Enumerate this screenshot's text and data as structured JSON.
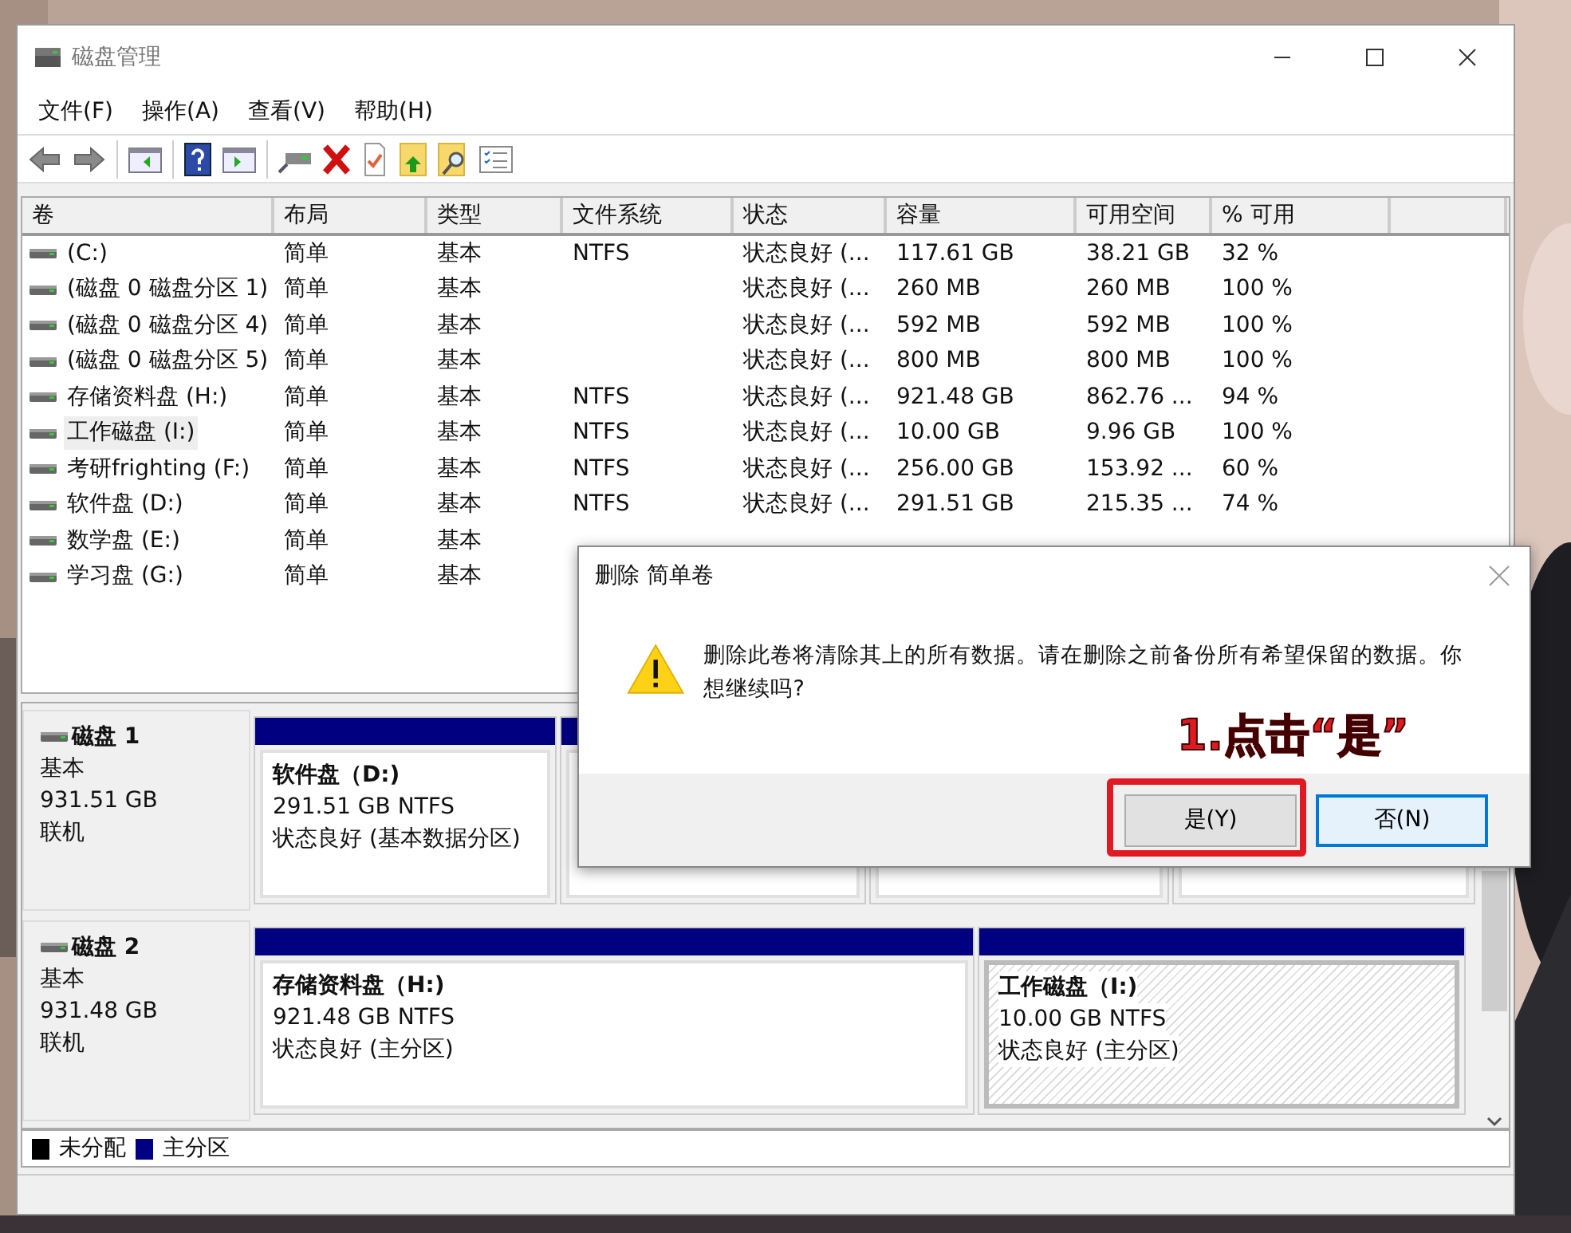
{
  "window": {
    "title": "磁盘管理"
  },
  "menu": [
    "文件(F)",
    "操作(A)",
    "查看(V)",
    "帮助(H)"
  ],
  "table": {
    "columns": [
      "卷",
      "布局",
      "类型",
      "文件系统",
      "状态",
      "容量",
      "可用空间",
      "% 可用"
    ],
    "rows": [
      {
        "selected": false,
        "cells": [
          "(C:)",
          "简单",
          "基本",
          "NTFS",
          "状态良好 (...",
          "117.61 GB",
          "38.21 GB",
          "32 %"
        ]
      },
      {
        "selected": false,
        "cells": [
          "(磁盘 0 磁盘分区 1)",
          "简单",
          "基本",
          "",
          "状态良好 (...",
          "260 MB",
          "260 MB",
          "100 %"
        ]
      },
      {
        "selected": false,
        "cells": [
          "(磁盘 0 磁盘分区 4)",
          "简单",
          "基本",
          "",
          "状态良好 (...",
          "592 MB",
          "592 MB",
          "100 %"
        ]
      },
      {
        "selected": false,
        "cells": [
          "(磁盘 0 磁盘分区 5)",
          "简单",
          "基本",
          "",
          "状态良好 (...",
          "800 MB",
          "800 MB",
          "100 %"
        ]
      },
      {
        "selected": false,
        "cells": [
          "存储资料盘 (H:)",
          "简单",
          "基本",
          "NTFS",
          "状态良好 (...",
          "921.48 GB",
          "862.76 ...",
          "94 %"
        ]
      },
      {
        "selected": true,
        "cells": [
          "工作磁盘 (I:)",
          "简单",
          "基本",
          "NTFS",
          "状态良好 (...",
          "10.00 GB",
          "9.96 GB",
          "100 %"
        ]
      },
      {
        "selected": false,
        "cells": [
          "考研frighting (F:)",
          "简单",
          "基本",
          "NTFS",
          "状态良好 (...",
          "256.00 GB",
          "153.92 ...",
          "60 %"
        ]
      },
      {
        "selected": false,
        "cells": [
          "软件盘 (D:)",
          "简单",
          "基本",
          "NTFS",
          "状态良好 (...",
          "291.51 GB",
          "215.35 ...",
          "74 %"
        ]
      },
      {
        "selected": false,
        "cells": [
          "数学盘 (E:)",
          "简单",
          "基本"
        ]
      },
      {
        "selected": false,
        "cells": [
          "学习盘 (G:)",
          "简单",
          "基本"
        ]
      }
    ]
  },
  "disks": [
    {
      "name": "磁盘 1",
      "type": "基本",
      "size": "931.51 GB",
      "state": "联机",
      "partitions": [
        {
          "name": "软件盘（D:)",
          "size": "291.51 GB NTFS",
          "status": "状态良好 (基本数据分区)",
          "selected": false
        }
      ]
    },
    {
      "name": "磁盘 2",
      "type": "基本",
      "size": "931.48 GB",
      "state": "联机",
      "partitions": [
        {
          "name": "存储资料盘（H:)",
          "size": "921.48 GB NTFS",
          "status": "状态良好 (主分区)",
          "selected": false
        },
        {
          "name": "工作磁盘（I:)",
          "size": "10.00 GB NTFS",
          "status": "状态良好 (主分区)",
          "selected": true
        }
      ]
    }
  ],
  "legend": [
    {
      "label": "未分配",
      "color": "#000000"
    },
    {
      "label": "主分区",
      "color": "#000080"
    }
  ],
  "dialog": {
    "title": "删除 简单卷",
    "message": "删除此卷将清除其上的所有数据。请在删除之前备份所有希望保留的数据。你想继续吗?",
    "buttons": [
      {
        "label": "是(Y)",
        "focused": false
      },
      {
        "label": "否(N)",
        "focused": true
      }
    ]
  },
  "annotation": {
    "text": "1.点击“是”"
  }
}
